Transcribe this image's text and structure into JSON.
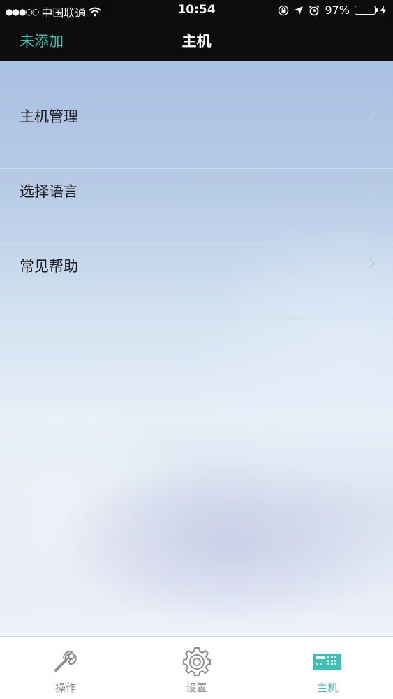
{
  "status_bar": {
    "signal": "●●●○○",
    "carrier": "中国联通",
    "time": "10:54",
    "battery": "97%",
    "battery_level": 0.97,
    "battery_color": "#4cd964"
  },
  "nav": {
    "left_label": "未添加",
    "title": "主机"
  },
  "menu": {
    "items": [
      {
        "label": "主机管理"
      },
      {
        "label": "选择语言"
      },
      {
        "label": "常见帮助"
      }
    ]
  },
  "tabs": [
    {
      "label": "操作",
      "icon": "wrench-icon"
    },
    {
      "label": "设置",
      "icon": "gear-icon"
    },
    {
      "label": "主机",
      "icon": "host-device-icon",
      "active": true
    }
  ],
  "colors": {
    "accent": "#3fbfb4",
    "bar_background": "#0c0c0c",
    "tab_inactive": "#8e8e8e"
  }
}
